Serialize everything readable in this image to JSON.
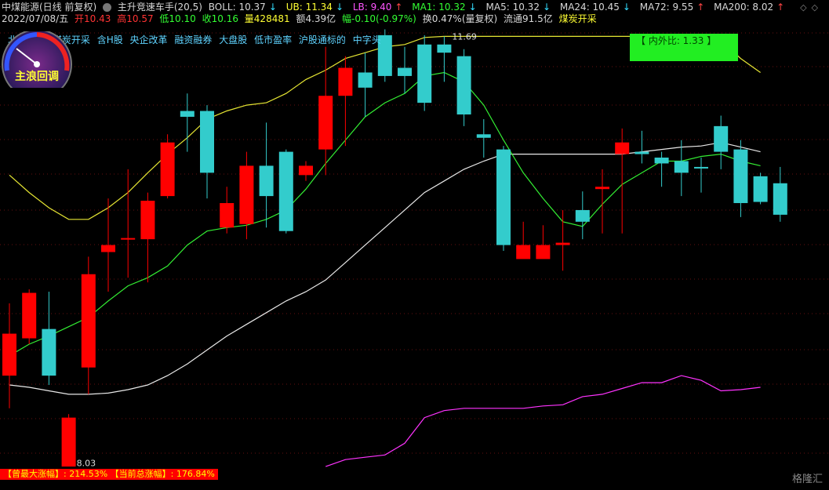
{
  "header": {
    "name": "中煤能源(日线 前复权)",
    "indicator": "主升竞速车手(20,5)",
    "boll": "BOLL: 10.37",
    "boll_arrow": "↓",
    "ub": "UB: 11.34",
    "ub_arrow": "↓",
    "lb": "LB: 9.40",
    "lb_arrow": "↑",
    "ma1": "MA1: 10.32",
    "ma1_arrow": "↓",
    "ma5": "MA5: 10.32",
    "ma5_arrow": "↓",
    "ma24": "MA24: 10.45",
    "ma24_arrow": "↓",
    "ma72": "MA72: 9.55",
    "ma72_arrow": "↑",
    "ma200": "MA200: 8.02",
    "ma200_arrow": "↑",
    "window_controls": "◇◇"
  },
  "quote": {
    "date": "2022/07/08/五",
    "open": "开10.43",
    "high": "高10.57",
    "low": "低10.10",
    "close": "收10.16",
    "volume": "量428481",
    "amount": "额4.39亿",
    "change": "幅-0.10(-0.97%)",
    "turnover": "换0.47%(量复权)",
    "float_cap": "流通91.5亿",
    "sector": "煤炭开采"
  },
  "tags": [
    "北京板块",
    "煤炭开采",
    "含H股",
    "央企改革",
    "融资融券",
    "大盘股",
    "低市盈率",
    "沪股通标的",
    "中字头"
  ],
  "gauge_label": "主浪回调",
  "ratio_box": "【 内外比: 1.33 】",
  "bottom_bar": "【曾最大涨幅】: 214.53% 【当前总涨幅】: 176.84%",
  "watermark": "格隆汇",
  "colors": {
    "up": "#ff0000",
    "down": "#33cccc",
    "ub_line": "#e6e633",
    "ma_line": "#33ee33",
    "mid_line": "#e8e8e8",
    "sub_line": "#ff33ff"
  },
  "chart_data": {
    "type": "candlestick",
    "y_range": [
      7.9,
      11.8
    ],
    "annotations": [
      {
        "label": "11.69",
        "value": 11.69
      },
      {
        "label": "8.03",
        "value": 8.03
      }
    ],
    "candles": [
      {
        "o": 8.78,
        "c": 9.14,
        "h": 9.4,
        "l": 8.5
      },
      {
        "o": 9.1,
        "c": 9.49,
        "h": 9.52,
        "l": 9.05
      },
      {
        "o": 9.18,
        "c": 8.78,
        "h": 9.5,
        "l": 8.7
      },
      {
        "o": 8.0,
        "c": 8.42,
        "h": 8.45,
        "l": 8.03
      },
      {
        "o": 8.85,
        "c": 9.65,
        "h": 9.8,
        "l": 8.62
      },
      {
        "o": 9.84,
        "c": 9.9,
        "h": 10.3,
        "l": 9.5
      },
      {
        "o": 9.95,
        "c": 9.96,
        "h": 10.55,
        "l": 9.62
      },
      {
        "o": 9.95,
        "c": 10.28,
        "h": 10.35,
        "l": 9.58
      },
      {
        "o": 10.32,
        "c": 10.78,
        "h": 10.85,
        "l": 10.3
      },
      {
        "o": 11.05,
        "c": 11.0,
        "h": 11.2,
        "l": 10.7
      },
      {
        "o": 11.05,
        "c": 10.52,
        "h": 11.1,
        "l": 10.3
      },
      {
        "o": 10.05,
        "c": 10.26,
        "h": 10.4,
        "l": 10.0
      },
      {
        "o": 10.08,
        "c": 10.58,
        "h": 10.7,
        "l": 9.95
      },
      {
        "o": 10.58,
        "c": 10.32,
        "h": 10.95,
        "l": 10.05
      },
      {
        "o": 10.7,
        "c": 10.02,
        "h": 10.72,
        "l": 10.0
      },
      {
        "o": 10.5,
        "c": 10.58,
        "h": 10.62,
        "l": 10.45
      },
      {
        "o": 10.72,
        "c": 11.18,
        "h": 11.6,
        "l": 10.5
      },
      {
        "o": 11.18,
        "c": 11.42,
        "h": 11.52,
        "l": 10.75
      },
      {
        "o": 11.38,
        "c": 11.25,
        "h": 11.55,
        "l": 11.0
      },
      {
        "o": 11.7,
        "c": 11.35,
        "h": 11.75,
        "l": 11.3
      },
      {
        "o": 11.42,
        "c": 11.35,
        "h": 11.6,
        "l": 11.2
      },
      {
        "o": 11.62,
        "c": 11.12,
        "h": 11.7,
        "l": 11.05
      },
      {
        "o": 11.62,
        "c": 11.55,
        "h": 11.69,
        "l": 11.3
      },
      {
        "o": 11.52,
        "c": 11.02,
        "h": 11.58,
        "l": 10.92
      },
      {
        "o": 10.85,
        "c": 10.82,
        "h": 10.98,
        "l": 10.65
      },
      {
        "o": 10.72,
        "c": 9.9,
        "h": 10.75,
        "l": 9.85
      },
      {
        "o": 9.78,
        "c": 9.9,
        "h": 10.1,
        "l": 9.85
      },
      {
        "o": 9.78,
        "c": 9.9,
        "h": 10.07,
        "l": 9.87
      },
      {
        "o": 9.9,
        "c": 9.92,
        "h": 10.2,
        "l": 9.68
      },
      {
        "o": 10.2,
        "c": 10.1,
        "h": 10.36,
        "l": 9.95
      },
      {
        "o": 10.38,
        "c": 10.4,
        "h": 10.55,
        "l": 10.0
      },
      {
        "o": 10.68,
        "c": 10.78,
        "h": 10.9,
        "l": 10.0
      },
      {
        "o": 10.7,
        "c": 10.68,
        "h": 10.88,
        "l": 10.6
      },
      {
        "o": 10.65,
        "c": 10.6,
        "h": 10.7,
        "l": 10.4
      },
      {
        "o": 10.62,
        "c": 10.52,
        "h": 10.8,
        "l": 10.32
      },
      {
        "o": 10.57,
        "c": 10.56,
        "h": 10.65,
        "l": 10.35
      },
      {
        "o": 10.92,
        "c": 10.7,
        "h": 11.01,
        "l": 10.55
      },
      {
        "o": 10.72,
        "c": 10.26,
        "h": 10.8,
        "l": 10.14
      },
      {
        "o": 10.49,
        "c": 10.27,
        "h": 10.52,
        "l": 10.25
      },
      {
        "o": 10.43,
        "c": 10.16,
        "h": 10.57,
        "l": 10.1
      }
    ],
    "ub_series": [
      10.5,
      10.35,
      10.22,
      10.12,
      10.12,
      10.22,
      10.35,
      10.52,
      10.68,
      10.82,
      10.98,
      11.05,
      11.1,
      11.12,
      11.2,
      11.32,
      11.4,
      11.5,
      11.55,
      11.6,
      11.62,
      11.68,
      11.69,
      11.69,
      11.69,
      11.69,
      11.69,
      11.69,
      11.69,
      11.69,
      11.69,
      11.69,
      11.69,
      11.69,
      11.69,
      11.69,
      11.66,
      11.5,
      11.38
    ],
    "ma_series": [
      8.95,
      9.05,
      9.12,
      9.2,
      9.28,
      9.42,
      9.55,
      9.62,
      9.72,
      9.9,
      10.02,
      10.05,
      10.07,
      10.12,
      10.2,
      10.38,
      10.6,
      10.8,
      11.0,
      11.12,
      11.2,
      11.35,
      11.38,
      11.3,
      11.1,
      10.8,
      10.52,
      10.3,
      10.1,
      10.06,
      10.25,
      10.42,
      10.52,
      10.62,
      10.62,
      10.66,
      10.68,
      10.62,
      10.58
    ],
    "mid_series": [
      8.7,
      8.68,
      8.65,
      8.62,
      8.62,
      8.63,
      8.66,
      8.7,
      8.78,
      8.88,
      9.0,
      9.12,
      9.22,
      9.32,
      9.42,
      9.5,
      9.6,
      9.75,
      9.9,
      10.05,
      10.2,
      10.35,
      10.45,
      10.55,
      10.62,
      10.68,
      10.68,
      10.68,
      10.68,
      10.68,
      10.68,
      10.68,
      10.7,
      10.72,
      10.74,
      10.75,
      10.78,
      10.74,
      10.7
    ],
    "sub_series": [
      null,
      null,
      null,
      null,
      null,
      null,
      null,
      null,
      null,
      null,
      null,
      null,
      null,
      null,
      null,
      null,
      8.0,
      8.06,
      8.08,
      8.1,
      8.2,
      8.42,
      8.48,
      8.5,
      8.5,
      8.5,
      8.5,
      8.52,
      8.53,
      8.6,
      8.62,
      8.67,
      8.72,
      8.72,
      8.78,
      8.74,
      8.65,
      8.66,
      8.68
    ]
  }
}
